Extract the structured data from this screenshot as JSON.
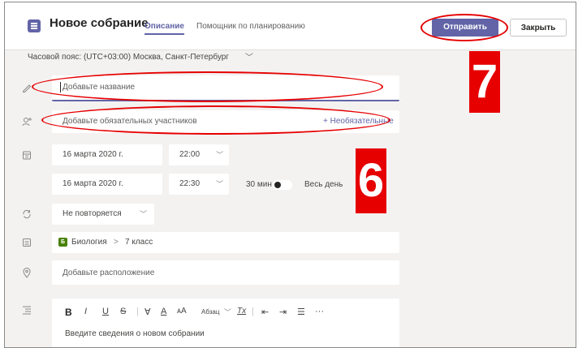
{
  "header": {
    "title": "Новое собрание",
    "tabs": [
      {
        "label": "Описание",
        "active": true
      },
      {
        "label": "Помощник по планированию",
        "active": false
      }
    ],
    "send_label": "Отправить",
    "close_label": "Закрыть"
  },
  "timezone": {
    "label": "Часовой пояс: (UTC+03:00) Москва, Санкт-Петербург",
    "chevron": "﹀"
  },
  "form": {
    "title_placeholder": "Добавьте название",
    "attendees_placeholder": "Добавьте обязательных участников",
    "optional_label": "+ Необязательные",
    "start_date": "16 марта 2020 г.",
    "start_time": "22:00",
    "end_date": "16 марта 2020 г.",
    "end_time": "22:30",
    "duration": "30 мин",
    "all_day_label": "Весь день",
    "all_day_on": false,
    "repeat": "Не повторяется",
    "channel_team_initial": "Б",
    "channel_team": "Биология",
    "channel_separator": ">",
    "channel_name": "7 класс",
    "location_placeholder": "Добавьте расположение",
    "editor_placeholder": "Введите сведения о новом собрании"
  },
  "toolbar": {
    "bold": "B",
    "italic": "I",
    "underline": "U",
    "strike": "S",
    "highlight": "∀",
    "font_color": "A",
    "font_size": "ᴀA",
    "paragraph": "Абзац",
    "clear_format": "Tx",
    "outdent": "⇤",
    "indent": "⇥",
    "bullets": "☰",
    "more": "···"
  },
  "annotations": {
    "step_6": "6",
    "step_7": "7",
    "color": "#e60000"
  },
  "colors": {
    "accent": "#6264a7",
    "background": "#f3f2f1"
  }
}
